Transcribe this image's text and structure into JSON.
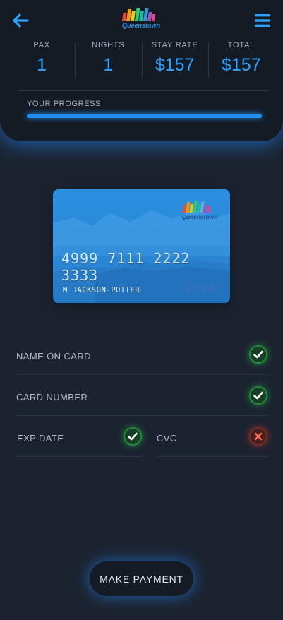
{
  "header": {
    "logo_text": "Queenstown",
    "stats": [
      {
        "label": "PAX",
        "value": "1"
      },
      {
        "label": "NIGHTS",
        "value": "1"
      },
      {
        "label": "STAY RATE",
        "value": "$157"
      },
      {
        "label": "TOTAL",
        "value": "$157"
      }
    ],
    "progress": {
      "label": "YOUR PROGRESS",
      "value": 1.0
    }
  },
  "card": {
    "logo_text": "Queenstown",
    "number": "4999 7111 2222 3333",
    "holder": "M JACKSON-POTTER",
    "brand": "VISA"
  },
  "fields": {
    "name_on_card": {
      "label": "NAME ON CARD",
      "status": "valid"
    },
    "card_number": {
      "label": "CARD NUMBER",
      "status": "valid"
    },
    "exp_date": {
      "label": "EXP DATE",
      "status": "valid"
    },
    "cvc": {
      "label": "CVC",
      "status": "invalid"
    }
  },
  "actions": {
    "pay_label": "MAKE PAYMENT"
  },
  "colors": {
    "accent": "#2aa3ff",
    "valid": "#2ecc40",
    "invalid": "#e84a30"
  },
  "icons": {
    "back": "arrow-left-icon",
    "menu": "hamburger-menu-icon",
    "valid": "check-icon",
    "invalid": "x-icon"
  }
}
